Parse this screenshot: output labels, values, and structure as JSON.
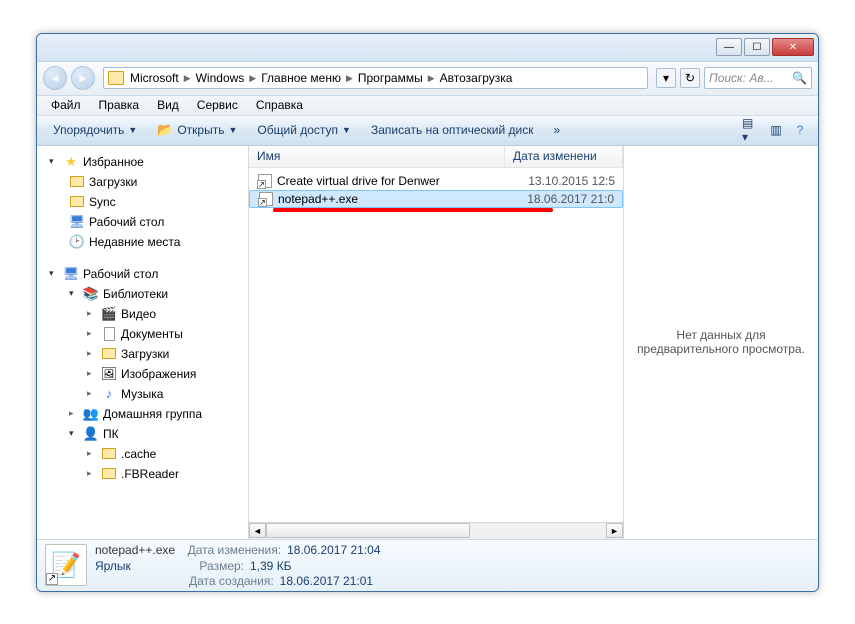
{
  "breadcrumbs": [
    "Microsoft",
    "Windows",
    "Главное меню",
    "Программы",
    "Автозагрузка"
  ],
  "search_placeholder": "Поиск: Ав...",
  "menu": [
    "Файл",
    "Правка",
    "Вид",
    "Сервис",
    "Справка"
  ],
  "toolbar": {
    "organize": "Упорядочить",
    "open": "Открыть",
    "share": "Общий доступ",
    "burn": "Записать на оптический диск",
    "more": "»"
  },
  "nav": {
    "favorites": "Избранное",
    "downloads": "Загрузки",
    "sync": "Sync",
    "desktop": "Рабочий стол",
    "recent": "Недавние места",
    "desktop2": "Рабочий стол",
    "libraries": "Библиотеки",
    "video": "Видео",
    "documents": "Документы",
    "downloads2": "Загрузки",
    "images": "Изображения",
    "music": "Музыка",
    "homegroup": "Домашняя группа",
    "pc": "ПК",
    "cache": ".cache",
    "fbreader": ".FBReader"
  },
  "columns": {
    "name": "Имя",
    "date": "Дата изменени"
  },
  "files": [
    {
      "name": "Create virtual drive for Denwer",
      "date": "13.10.2015 12:5",
      "selected": false
    },
    {
      "name": "notepad++.exe",
      "date": "18.06.2017 21:0",
      "selected": true
    }
  ],
  "preview_text": "Нет данных для предварительного просмотра.",
  "details": {
    "name": "notepad++.exe",
    "type": "Ярлык",
    "date_mod_label": "Дата изменения:",
    "date_mod": "18.06.2017 21:04",
    "size_label": "Размер:",
    "size": "1,39 КБ",
    "date_created_label": "Дата создания:",
    "date_created": "18.06.2017 21:01"
  }
}
